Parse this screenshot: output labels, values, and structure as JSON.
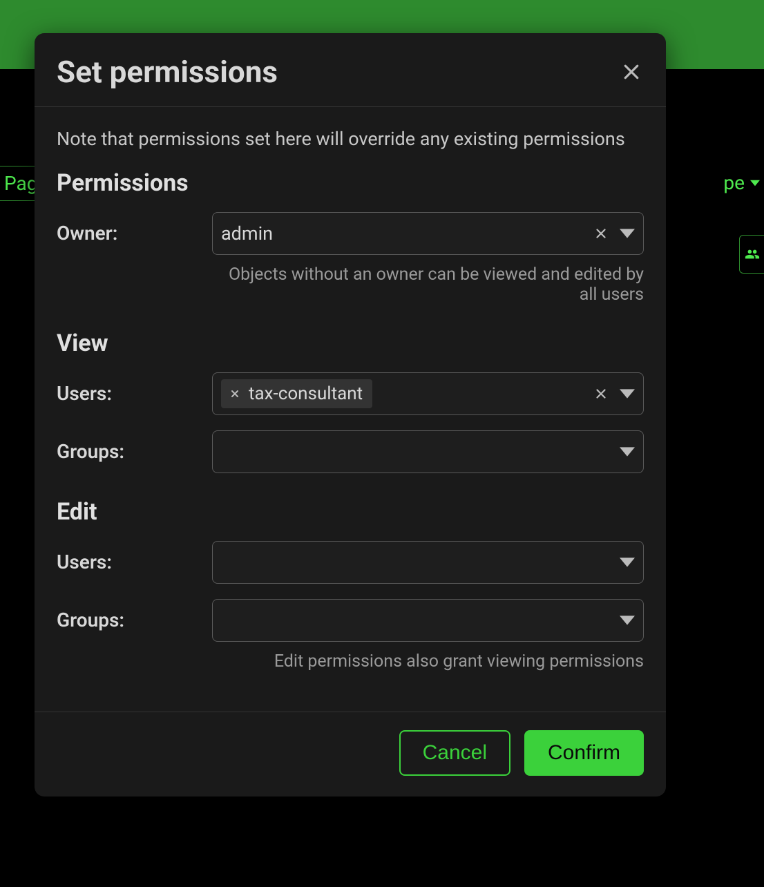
{
  "bg": {
    "left_tab": "Pag",
    "right_tab": "pe"
  },
  "modal": {
    "title": "Set permissions",
    "note": "Note that permissions set here will override any existing permissions",
    "sections": {
      "permissions": {
        "heading": "Permissions",
        "owner": {
          "label": "Owner:",
          "value": "admin",
          "helper": "Objects without an owner can be viewed and edited by all users"
        }
      },
      "view": {
        "heading": "View",
        "users": {
          "label": "Users:",
          "chips": [
            "tax-consultant"
          ]
        },
        "groups": {
          "label": "Groups:"
        }
      },
      "edit": {
        "heading": "Edit",
        "users": {
          "label": "Users:"
        },
        "groups": {
          "label": "Groups:",
          "helper": "Edit permissions also grant viewing permissions"
        }
      }
    },
    "buttons": {
      "cancel": "Cancel",
      "confirm": "Confirm"
    }
  }
}
